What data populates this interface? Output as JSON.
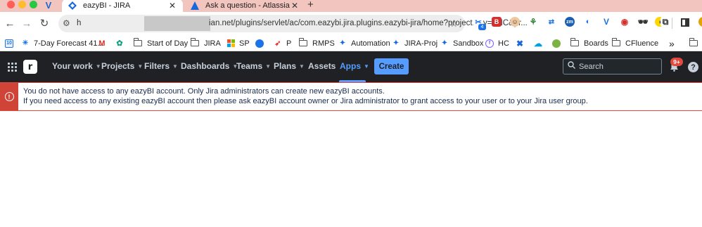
{
  "browser": {
    "tabs": [
      {
        "title": "eazyBI - JIRA",
        "active": true
      },
      {
        "title": "Ask a question - Atlassian Co",
        "active": false
      }
    ],
    "address_bar": {
      "url_start": "h",
      "url_visible": "ian.net/plugins/servlet/ac/com.eazybi.jira.plugins.eazybi-jira/home?project.key=FNC&pr..."
    },
    "extension_badge": "4",
    "extension_labels": {
      "zm": "zm"
    },
    "bookmarks": [
      {
        "label": "7-Day Forecast 41...",
        "icon": "weather-icon"
      },
      {
        "label": "",
        "icon": "gmail-icon"
      },
      {
        "label": "",
        "icon": "chatgpt-icon"
      },
      {
        "label": "Start of Day",
        "icon": "folder-icon"
      },
      {
        "label": "JIRA",
        "icon": "folder-icon"
      },
      {
        "label": "SP",
        "icon": "microsoft-icon"
      },
      {
        "label": "",
        "icon": "globe-icon"
      },
      {
        "label": "P",
        "icon": "p-icon"
      },
      {
        "label": "RMPS",
        "icon": "folder-icon"
      },
      {
        "label": "Automation",
        "icon": "jira-icon"
      },
      {
        "label": "JIRA-Proj",
        "icon": "jira-icon"
      },
      {
        "label": "Sandbox",
        "icon": "jira-icon"
      },
      {
        "label": "HC",
        "icon": "hc-icon"
      },
      {
        "label": "Boards",
        "icon": "folder-icon"
      },
      {
        "label": "CFluence",
        "icon": "folder-icon"
      }
    ],
    "bookmarks_overflow": "»"
  },
  "jira_nav": {
    "items": [
      {
        "label": "Your work",
        "has_chevron": true
      },
      {
        "label": "Projects",
        "has_chevron": true
      },
      {
        "label": "Filters",
        "has_chevron": true
      },
      {
        "label": "Dashboards",
        "has_chevron": true
      },
      {
        "label": "Teams",
        "has_chevron": true
      },
      {
        "label": "Plans",
        "has_chevron": true
      },
      {
        "label": "Assets",
        "has_chevron": false
      },
      {
        "label": "Apps",
        "has_chevron": true,
        "active": true
      }
    ],
    "create_label": "Create",
    "search_placeholder": "Search",
    "notification_badge": "9+",
    "help_label": "?",
    "logo_letter": "r",
    "accent_color": "#579dff",
    "nav_background": "#1f2125"
  },
  "error": {
    "line1": "You do not have access to any eazyBI account. Only Jira administrators can create new eazyBI accounts.",
    "line2": "If you need access to any existing eazyBI account then please ask eazyBI account owner or Jira administrator to grant access to your user or to your Jira user group.",
    "color": "#d04437"
  }
}
